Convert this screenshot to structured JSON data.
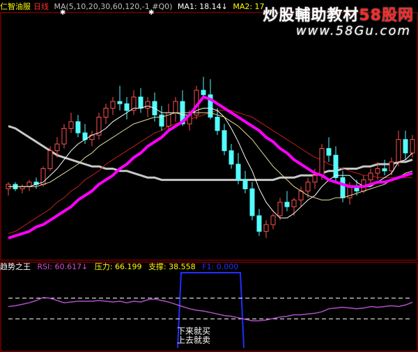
{
  "header": {
    "stock_name": "仁智油服",
    "period": "日线",
    "ma_params": "MA(5,10,20,30,60,120,-1 #Q0)",
    "ma1": "MA1: 18.14↓",
    "ma2": "MA2: 17"
  },
  "watermark": {
    "line1_prefix": "炒股輔助教材",
    "line1_brand": "58股网",
    "line2": "www.58Gu.com"
  },
  "subpanel": {
    "title": "趋势之王",
    "rsi": "RSI: 60.617↓",
    "pressure": "压力: 66.199",
    "support": "支撑: 38.558",
    "hidden": "F1: 0.000"
  },
  "annotation": {
    "line1": "下来就买",
    "line2": "上去就卖"
  },
  "colors": {
    "background": "#000000",
    "up": "#ff5050",
    "down": "#54fcfc",
    "ma_short": "#ffffff",
    "ma_mid": "#ffff00",
    "ma_long": "#ff00ff",
    "ma_very_long": "#c8c8c8",
    "border": "#b00000",
    "rsi_line": "#b050c8",
    "box": "#2030ff"
  },
  "chart_data": [
    {
      "type": "candlestick",
      "title": "仁智油服 日线",
      "ylim": [
        12.0,
        22.5
      ],
      "candles": [
        [
          15.0,
          15.3,
          14.7,
          15.2
        ],
        [
          15.2,
          15.3,
          14.9,
          15.0
        ],
        [
          15.0,
          15.2,
          14.8,
          15.1
        ],
        [
          15.1,
          15.4,
          14.9,
          15.3
        ],
        [
          15.3,
          15.5,
          15.0,
          15.2
        ],
        [
          15.2,
          16.0,
          15.1,
          15.9
        ],
        [
          15.9,
          16.9,
          15.8,
          16.7
        ],
        [
          16.7,
          17.3,
          16.4,
          17.0
        ],
        [
          17.0,
          17.9,
          16.8,
          17.7
        ],
        [
          17.7,
          18.4,
          17.5,
          18.0
        ],
        [
          18.0,
          18.3,
          17.3,
          17.5
        ],
        [
          17.5,
          17.9,
          17.0,
          17.2
        ],
        [
          17.2,
          17.6,
          16.9,
          17.4
        ],
        [
          17.4,
          18.4,
          17.2,
          18.2
        ],
        [
          18.2,
          18.8,
          17.9,
          18.6
        ],
        [
          18.6,
          19.1,
          18.3,
          18.9
        ],
        [
          18.9,
          19.6,
          18.5,
          18.8
        ],
        [
          18.8,
          19.1,
          18.1,
          18.5
        ],
        [
          18.5,
          19.4,
          18.3,
          19.1
        ],
        [
          19.1,
          19.5,
          18.4,
          18.6
        ],
        [
          18.6,
          19.1,
          18.2,
          18.9
        ],
        [
          18.9,
          19.3,
          18.0,
          18.3
        ],
        [
          18.3,
          18.7,
          17.6,
          17.8
        ],
        [
          17.8,
          18.8,
          17.6,
          18.4
        ],
        [
          18.4,
          19.1,
          18.0,
          18.9
        ],
        [
          18.9,
          19.4,
          17.8,
          17.9
        ],
        [
          17.9,
          18.5,
          17.6,
          18.3
        ],
        [
          18.3,
          19.6,
          18.1,
          19.4
        ],
        [
          19.4,
          20.0,
          19.0,
          19.2
        ],
        [
          19.2,
          19.9,
          18.1,
          18.2
        ],
        [
          18.2,
          18.6,
          17.4,
          17.6
        ],
        [
          17.6,
          17.9,
          16.5,
          16.7
        ],
        [
          16.7,
          17.0,
          15.9,
          16.1
        ],
        [
          16.1,
          16.6,
          15.2,
          15.4
        ],
        [
          15.4,
          15.8,
          14.8,
          15.0
        ],
        [
          15.0,
          15.3,
          13.6,
          13.8
        ],
        [
          13.8,
          14.1,
          12.9,
          13.1
        ],
        [
          13.1,
          13.6,
          12.8,
          13.4
        ],
        [
          13.4,
          13.9,
          13.2,
          13.8
        ],
        [
          13.8,
          14.6,
          13.6,
          14.4
        ],
        [
          14.4,
          14.9,
          14.0,
          14.2
        ],
        [
          14.2,
          14.6,
          13.8,
          14.5
        ],
        [
          14.5,
          15.1,
          14.2,
          14.9
        ],
        [
          14.9,
          15.5,
          14.6,
          15.3
        ],
        [
          15.3,
          15.9,
          15.0,
          15.6
        ],
        [
          15.6,
          17.0,
          15.4,
          16.8
        ],
        [
          16.8,
          17.3,
          16.2,
          16.5
        ],
        [
          16.5,
          16.9,
          15.3,
          15.5
        ],
        [
          15.5,
          15.8,
          14.4,
          14.6
        ],
        [
          14.6,
          15.3,
          14.3,
          15.1
        ],
        [
          15.1,
          15.4,
          14.7,
          14.9
        ],
        [
          14.9,
          15.6,
          14.8,
          15.4
        ],
        [
          15.4,
          15.9,
          15.1,
          15.7
        ],
        [
          15.7,
          16.2,
          15.4,
          15.9
        ],
        [
          15.9,
          16.3,
          15.6,
          15.8
        ],
        [
          15.8,
          16.4,
          15.6,
          16.2
        ],
        [
          16.2,
          17.6,
          16.0,
          17.2
        ],
        [
          17.2,
          17.6,
          16.3,
          16.6
        ],
        [
          16.6,
          17.4,
          16.4,
          17.2
        ]
      ],
      "series": [
        {
          "name": "MA1",
          "values": [
            15.1,
            15.1,
            15.1,
            15.1,
            15.2,
            15.3,
            15.6,
            15.9,
            16.3,
            16.7,
            17.0,
            17.2,
            17.4,
            17.5,
            17.7,
            18.0,
            18.2,
            18.4,
            18.6,
            18.6,
            18.7,
            18.6,
            18.4,
            18.4,
            18.4,
            18.3,
            18.3,
            18.5,
            18.6,
            18.6,
            18.5,
            18.2,
            17.7,
            17.1,
            16.4,
            15.8,
            15.0,
            14.4,
            14.0,
            13.7,
            13.7,
            13.9,
            14.2,
            14.5,
            14.7,
            15.1,
            15.4,
            15.6,
            15.6,
            15.6,
            15.3,
            15.1,
            15.1,
            15.3,
            15.5,
            15.7,
            16.2,
            16.3,
            16.6
          ]
        },
        {
          "name": "MA2",
          "values": [
            15.1,
            15.1,
            15.1,
            15.1,
            15.1,
            15.2,
            15.3,
            15.5,
            15.7,
            15.9,
            16.1,
            16.4,
            16.6,
            16.9,
            17.1,
            17.3,
            17.5,
            17.7,
            17.9,
            18.0,
            18.1,
            18.2,
            18.2,
            18.3,
            18.4,
            18.4,
            18.4,
            18.4,
            18.4,
            18.4,
            18.3,
            18.2,
            18.0,
            17.8,
            17.5,
            17.2,
            16.8,
            16.4,
            16.0,
            15.7,
            15.4,
            15.1,
            14.9,
            14.7,
            14.6,
            14.5,
            14.5,
            14.6,
            14.6,
            14.7,
            14.8,
            14.9,
            15.0,
            15.1,
            15.2,
            15.4,
            15.5,
            15.7,
            15.8
          ]
        },
        {
          "name": "MA3",
          "values": [
            13.0,
            13.1,
            13.3,
            13.5,
            13.7,
            13.9,
            14.1,
            14.4,
            14.6,
            14.9,
            15.1,
            15.4,
            15.6,
            15.8,
            16.1,
            16.3,
            16.5,
            16.7,
            16.9,
            17.1,
            17.3,
            17.5,
            17.6,
            17.8,
            17.9,
            18.0,
            18.1,
            18.2,
            18.3,
            18.4,
            18.5,
            18.5,
            18.5,
            18.4,
            18.3,
            18.2,
            18.0,
            17.8,
            17.6,
            17.4,
            17.2,
            17.0,
            16.8,
            16.6,
            16.4,
            16.3,
            16.1,
            16.0,
            15.9,
            15.8,
            15.7,
            15.6,
            15.6,
            15.5,
            15.5,
            15.5,
            15.5,
            15.5,
            15.5
          ]
        },
        {
          "name": "MA4",
          "values": [
            12.8,
            12.9,
            13.0,
            13.1,
            13.3,
            13.4,
            13.6,
            13.8,
            14.0,
            14.2,
            14.5,
            14.7,
            14.9,
            15.2,
            15.4,
            15.6,
            15.9,
            16.1,
            16.4,
            16.6,
            16.9,
            17.1,
            17.3,
            17.6,
            17.8,
            18.0,
            18.3,
            18.7,
            19.1,
            19.0,
            18.8,
            18.6,
            18.4,
            18.2,
            18.0,
            17.8,
            17.6,
            17.3,
            17.1,
            16.8,
            16.6,
            16.3,
            16.1,
            15.9,
            15.7,
            15.6,
            15.4,
            15.3,
            15.2,
            15.1,
            15.1,
            15.1,
            15.2,
            15.3,
            15.3,
            15.4,
            15.5,
            15.6,
            15.7
          ]
        },
        {
          "name": "MA5",
          "values": [
            17.8,
            17.7,
            17.5,
            17.3,
            17.1,
            16.9,
            16.7,
            16.5,
            16.4,
            16.3,
            16.2,
            16.1,
            16.0,
            16.0,
            15.9,
            15.9,
            15.8,
            15.8,
            15.7,
            15.6,
            15.5,
            15.5,
            15.4,
            15.4,
            15.4,
            15.4,
            15.4,
            15.4,
            15.4,
            15.4,
            15.4,
            15.4,
            15.4,
            15.4,
            15.4,
            15.4,
            15.4,
            15.4,
            15.4,
            15.5,
            15.5,
            15.5,
            15.6,
            15.6,
            15.6,
            15.7,
            15.8,
            15.8,
            15.9,
            15.9,
            15.9,
            16.0,
            16.0,
            16.1,
            16.1,
            16.1,
            16.2,
            16.2,
            16.3
          ]
        }
      ]
    },
    {
      "type": "line",
      "title": "趋势之王",
      "ylim": [
        0,
        100
      ],
      "series": [
        {
          "name": "RSI",
          "values": [
            55,
            56,
            58,
            60,
            63,
            67,
            66,
            63,
            60,
            61,
            62,
            62,
            62,
            63,
            62,
            61,
            62,
            60,
            62,
            61,
            64,
            65,
            63,
            61,
            58,
            55,
            52,
            50,
            49,
            47,
            45,
            43,
            42,
            40,
            38,
            36,
            36,
            37,
            39,
            41,
            42,
            44,
            44,
            45,
            46,
            48,
            52,
            53,
            54,
            53,
            52,
            53,
            55,
            54,
            55,
            56,
            55,
            57,
            60.617
          ]
        },
        {
          "name": "压力",
          "values": [
            66.199
          ]
        },
        {
          "name": "支撑",
          "values": [
            38.558
          ]
        }
      ]
    }
  ]
}
